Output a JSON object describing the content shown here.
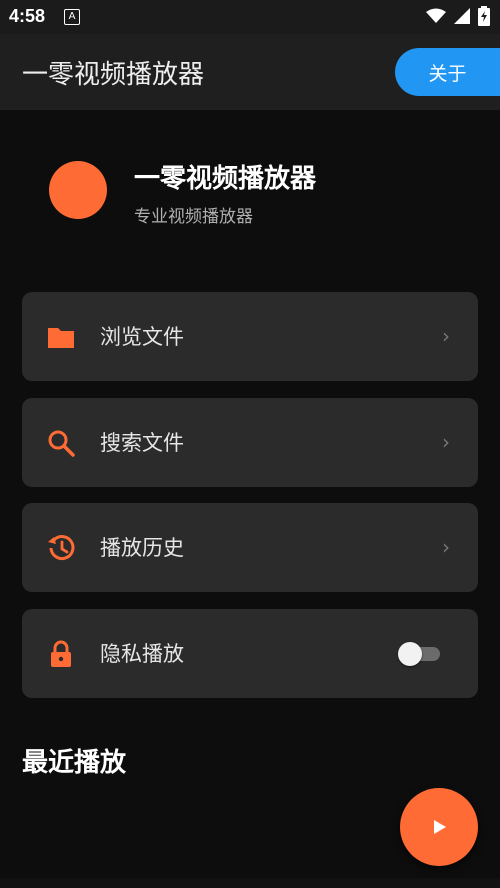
{
  "status_bar": {
    "time": "4:58",
    "notification_letter": "A"
  },
  "app_bar": {
    "title": "一零视频播放器",
    "about_label": "关于"
  },
  "header": {
    "app_name": "一零视频播放器",
    "subtitle": "专业视频播放器"
  },
  "menu": [
    {
      "label": "浏览文件",
      "icon": "folder-icon"
    },
    {
      "label": "搜索文件",
      "icon": "search-icon"
    },
    {
      "label": "播放历史",
      "icon": "history-icon"
    },
    {
      "label": "隐私播放",
      "icon": "lock-icon",
      "toggle": false
    }
  ],
  "recent": {
    "title": "最近播放"
  },
  "colors": {
    "accent": "#ff6b35",
    "about_button": "#2196f3",
    "card_bg": "#2b2b2b"
  }
}
